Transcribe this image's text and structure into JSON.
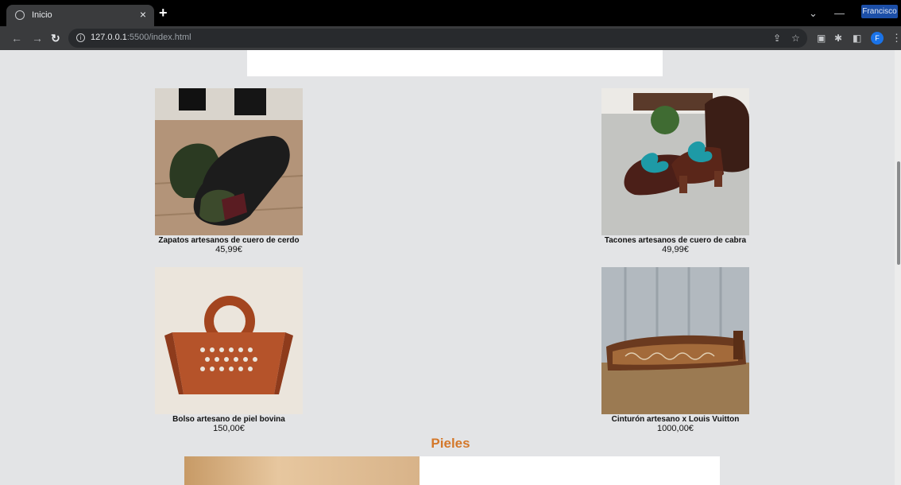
{
  "browser": {
    "tab_title": "Inicio",
    "tab_close": "×",
    "new_tab": "+",
    "url_host": "127.0.0.1",
    "url_rest": ":5500/index.html",
    "profile_name": "Francisco",
    "avatar_letter": "F",
    "minimize": "—",
    "tab_search": "⌄"
  },
  "products": [
    {
      "name": "Zapatos artesanos de cuero de cerdo",
      "price": "45,99€",
      "image": "leather-shoes"
    },
    {
      "name": "Tacones artesanos de cuero de cabra",
      "price": "49,99€",
      "image": "heeled-shoes"
    },
    {
      "name": "Bolso artesano de piel bovina",
      "price": "150,00€",
      "image": "leather-bag"
    },
    {
      "name": "Cinturón artesano x Louis Vuitton",
      "price": "1000,00€",
      "image": "leather-belt"
    }
  ],
  "section": {
    "title": "Pieles"
  },
  "colors": {
    "accent": "#d4782a",
    "page_bg": "#e3e4e6"
  }
}
